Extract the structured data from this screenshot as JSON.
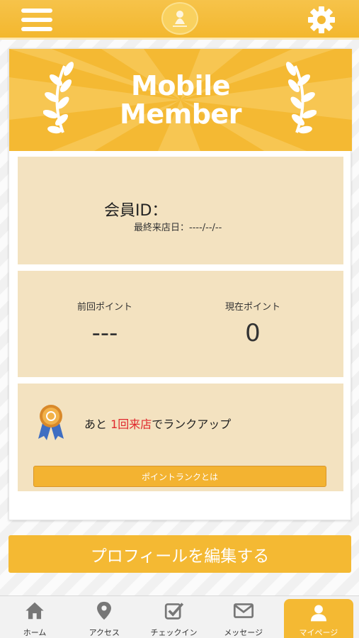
{
  "header": {
    "menu_icon": "hamburger-icon",
    "logo_icon": "shop-logo",
    "settings_icon": "gear-icon"
  },
  "banner": {
    "title_line1": "Mobile",
    "title_line2": "Member",
    "decor_icon": "laurel-icon"
  },
  "member": {
    "id_label": "会員ID：",
    "last_visit": "最終来店日：----/--/--"
  },
  "points": {
    "previous_label": "前回ポイント",
    "previous_value": "---",
    "current_label": "現在ポイント",
    "current_value": "0"
  },
  "rank": {
    "medal_icon": "medal-icon",
    "prefix": "あと ",
    "highlight": "1回来店",
    "suffix": "でランクアップ",
    "button_label": "ポイントランクとは"
  },
  "edit_profile_label": "プロフィールを編集する",
  "tabs": [
    {
      "label": "ホーム",
      "icon": "home-icon"
    },
    {
      "label": "アクセス",
      "icon": "map-pin-icon"
    },
    {
      "label": "チェックイン",
      "icon": "checkbox-icon"
    },
    {
      "label": "メッセージ",
      "icon": "mail-icon"
    },
    {
      "label": "マイページ",
      "icon": "user-icon",
      "active": true
    }
  ],
  "colors": {
    "accent": "#f4b933",
    "panel": "#f3e2c0",
    "highlight": "#e0282d"
  }
}
